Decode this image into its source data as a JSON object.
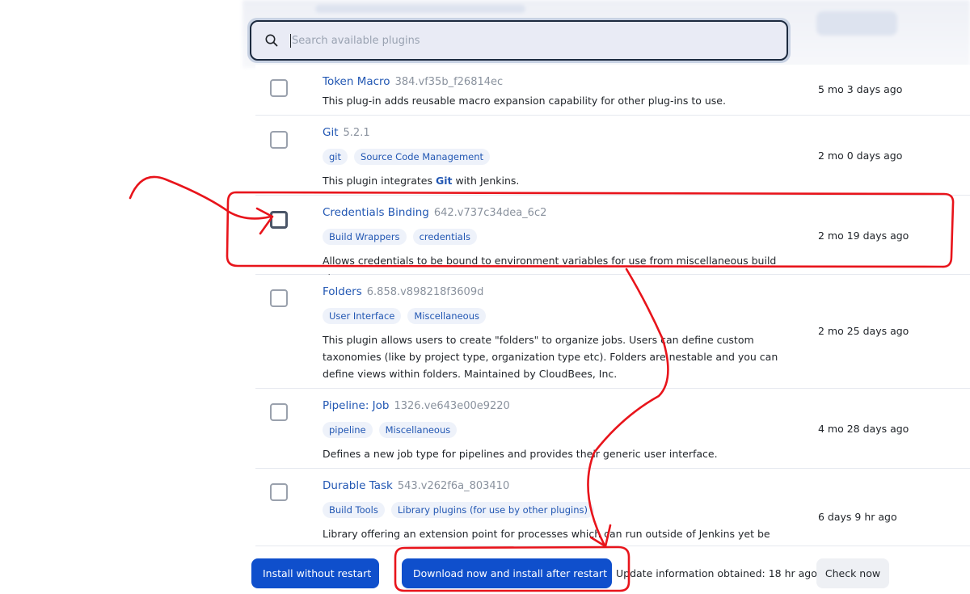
{
  "search": {
    "placeholder": "Search available plugins"
  },
  "plugins": [
    {
      "name": "Token Macro",
      "version": "384.vf35b_f26814ec",
      "tags": [],
      "description": "This plug-in adds reusable macro expansion capability for other plug-ins to use.",
      "released": "5 mo 3 days ago"
    },
    {
      "name": "Git",
      "version": "5.2.1",
      "tags": [
        "git",
        "Source Code Management"
      ],
      "description_prefix": "This plugin integrates ",
      "description_link": "Git",
      "description_suffix": " with Jenkins.",
      "released": "2 mo 0 days ago"
    },
    {
      "name": "Credentials Binding",
      "version": "642.v737c34dea_6c2",
      "tags": [
        "Build Wrappers",
        "credentials"
      ],
      "description": "Allows credentials to be bound to environment variables for use from miscellaneous build steps.",
      "released": "2 mo 19 days ago"
    },
    {
      "name": "Folders",
      "version": "6.858.v898218f3609d",
      "tags": [
        "User Interface",
        "Miscellaneous"
      ],
      "description": "This plugin allows users to create \"folders\" to organize jobs. Users can define custom taxonomies (like by project type, organization type etc). Folders are nestable and you can define views within folders. Maintained by CloudBees, Inc.",
      "released": "2 mo 25 days ago"
    },
    {
      "name": "Pipeline: Job",
      "version": "1326.ve643e00e9220",
      "tags": [
        "pipeline",
        "Miscellaneous"
      ],
      "description": "Defines a new job type for pipelines and provides their generic user interface.",
      "released": "4 mo 28 days ago"
    },
    {
      "name": "Durable Task",
      "version": "543.v262f6a_803410",
      "tags": [
        "Build Tools",
        "Library plugins (for use by other plugins)"
      ],
      "description": "Library offering an extension point for processes which can run outside of Jenkins yet be",
      "released": "6 days 9 hr ago"
    }
  ],
  "footer": {
    "install_without_restart": "Install without restart",
    "download_and_install": "Download now and install after restart",
    "update_info": "Update information obtained: 18 hr ago",
    "check_now": "Check now"
  },
  "colors": {
    "link": "#2257b3",
    "primary_button": "#0f4fcc",
    "annotation": "#e8141b"
  }
}
